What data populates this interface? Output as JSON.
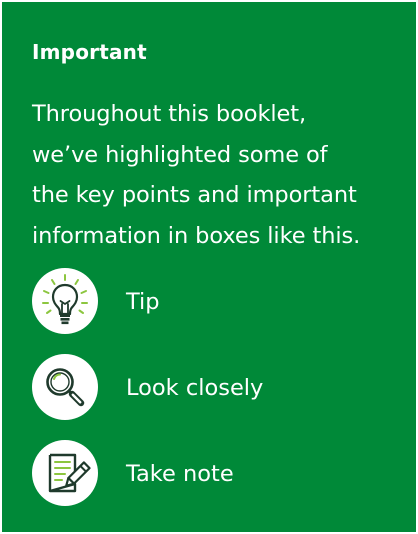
{
  "box": {
    "title": "Important",
    "intro_lines": [
      "Throughout this booklet,",
      "we’ve highlighted some of",
      "the key points and important",
      "information in boxes like this."
    ],
    "legend": [
      {
        "icon": "lightbulb-icon",
        "label": "Tip"
      },
      {
        "icon": "magnifier-icon",
        "label": "Look closely"
      },
      {
        "icon": "note-pencil-icon",
        "label": "Take note"
      }
    ]
  },
  "colors": {
    "background": "#008938",
    "text": "#ffffff",
    "icon_dark": "#1f3a2c",
    "icon_accent": "#8cc63f"
  }
}
